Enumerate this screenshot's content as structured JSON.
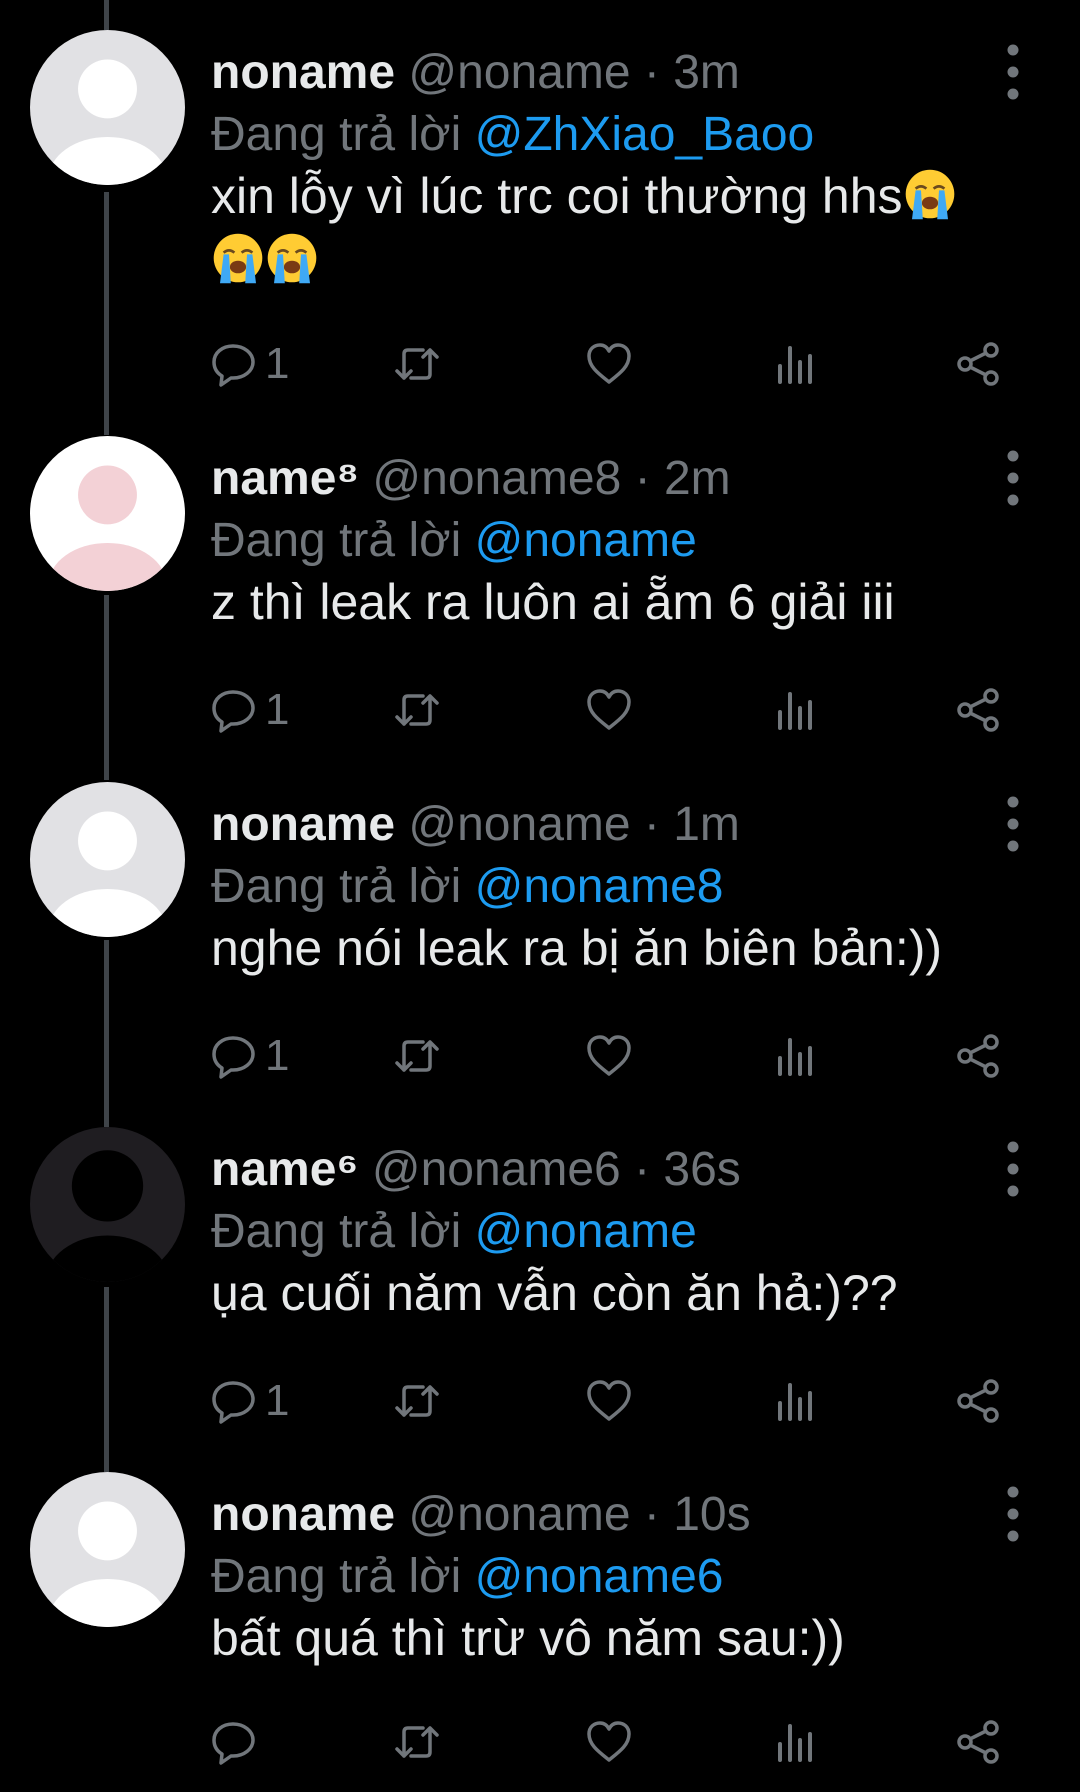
{
  "colors": {
    "background": "#000000",
    "text": "#e7e9ea",
    "muted": "#71767b",
    "accent": "#1d9bf0",
    "thread_line": "#3f4449"
  },
  "reply_prefix": "Đang trả lời",
  "tweets": [
    {
      "name": "noname",
      "handle": "@noname",
      "separator": "·",
      "time": "3m",
      "reply_to": "@ZhXiao_Baoo",
      "text": "xin lỗy vì lúc trc coi thường hhs",
      "emoji_count": 3,
      "emoji_icon": "loudly-crying-face-icon",
      "avatar": "default-light",
      "reply_count": "1"
    },
    {
      "name": "name⁸",
      "handle": "@noname8",
      "separator": "·",
      "time": "2m",
      "reply_to": "@noname",
      "text": "z thì leak ra luôn ai ẵm 6 giải iii",
      "avatar": "default-pink",
      "reply_count": "1"
    },
    {
      "name": "noname",
      "handle": "@noname",
      "separator": "·",
      "time": "1m",
      "reply_to": "@noname8",
      "text": "nghe nói leak ra bị ăn biên bản:))",
      "avatar": "default-light",
      "reply_count": "1"
    },
    {
      "name": "name⁶",
      "handle": "@noname6",
      "separator": "·",
      "time": "36s",
      "reply_to": "@noname",
      "text": "ụa cuối năm vẫn còn ăn hả:)??",
      "avatar": "default-dark",
      "reply_count": "1"
    },
    {
      "name": "noname",
      "handle": "@noname",
      "separator": "·",
      "time": "10s",
      "reply_to": "@noname6",
      "text": "bất quá thì trừ vô năm sau:))",
      "avatar": "default-light",
      "reply_count": ""
    }
  ]
}
